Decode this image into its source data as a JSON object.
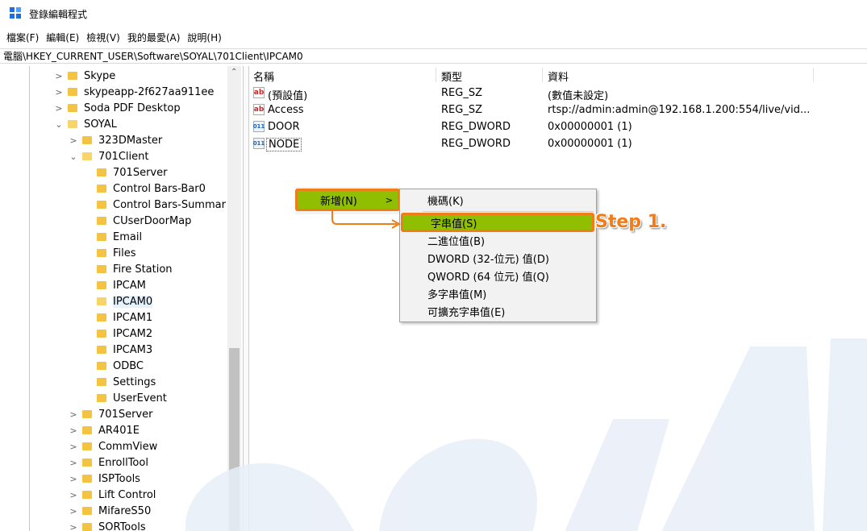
{
  "window": {
    "title": "登錄編輯程式"
  },
  "menubar": [
    "檔案(F)",
    "編輯(E)",
    "檢視(V)",
    "我的最愛(A)",
    "說明(H)"
  ],
  "address": "電腦\\HKEY_CURRENT_USER\\Software\\SOYAL\\701Client\\IPCAM0",
  "tree": [
    {
      "label": "Skype"
    },
    {
      "label": "skypeapp-2f627aa911ee"
    },
    {
      "label": "Soda PDF Desktop"
    },
    {
      "label": "SOYAL"
    },
    {
      "label": "323DMaster"
    },
    {
      "label": "701Client"
    },
    {
      "label": "701Server"
    },
    {
      "label": "Control Bars-Bar0"
    },
    {
      "label": "Control Bars-Summar"
    },
    {
      "label": "CUserDoorMap"
    },
    {
      "label": "Email"
    },
    {
      "label": "Files"
    },
    {
      "label": "Fire Station"
    },
    {
      "label": "IPCAM"
    },
    {
      "label": "IPCAM0"
    },
    {
      "label": "IPCAM1"
    },
    {
      "label": "IPCAM2"
    },
    {
      "label": "IPCAM3"
    },
    {
      "label": "ODBC"
    },
    {
      "label": "Settings"
    },
    {
      "label": "UserEvent"
    },
    {
      "label": "701Server"
    },
    {
      "label": "AR401E"
    },
    {
      "label": "CommView"
    },
    {
      "label": "EnrollTool"
    },
    {
      "label": "ISPTools"
    },
    {
      "label": "Lift Control"
    },
    {
      "label": "MifareS50"
    },
    {
      "label": "SORTools"
    }
  ],
  "list": {
    "headers": {
      "name": "名稱",
      "type": "類型",
      "data": "資料"
    },
    "rows": [
      {
        "icon": "ab",
        "name": "(預設值)",
        "type": "REG_SZ",
        "data": "(數值未設定)"
      },
      {
        "icon": "ab",
        "name": "Access",
        "type": "REG_SZ",
        "data": "rtsp://admin:admin@192.168.1.200:554/live/vid..."
      },
      {
        "icon": "011",
        "name": "DOOR",
        "type": "REG_DWORD",
        "data": "0x00000001 (1)"
      },
      {
        "icon": "011",
        "name": "NODE",
        "type": "REG_DWORD",
        "data": "0x00000001 (1)"
      }
    ]
  },
  "context_menu": {
    "new_label": "新增(N)",
    "submenu": [
      "機碼(K)",
      "字串值(S)",
      "二進位值(B)",
      "DWORD (32-位元) 值(D)",
      "QWORD (64 位元) 值(Q)",
      "多字串值(M)",
      "可擴充字串值(E)"
    ]
  },
  "annotation": {
    "step_label": "Step 1."
  },
  "watermark": "SOYAL",
  "colors": {
    "highlight_green": "#8fbf00",
    "highlight_border": "#ef7d1a",
    "folder": "#f5c342"
  }
}
